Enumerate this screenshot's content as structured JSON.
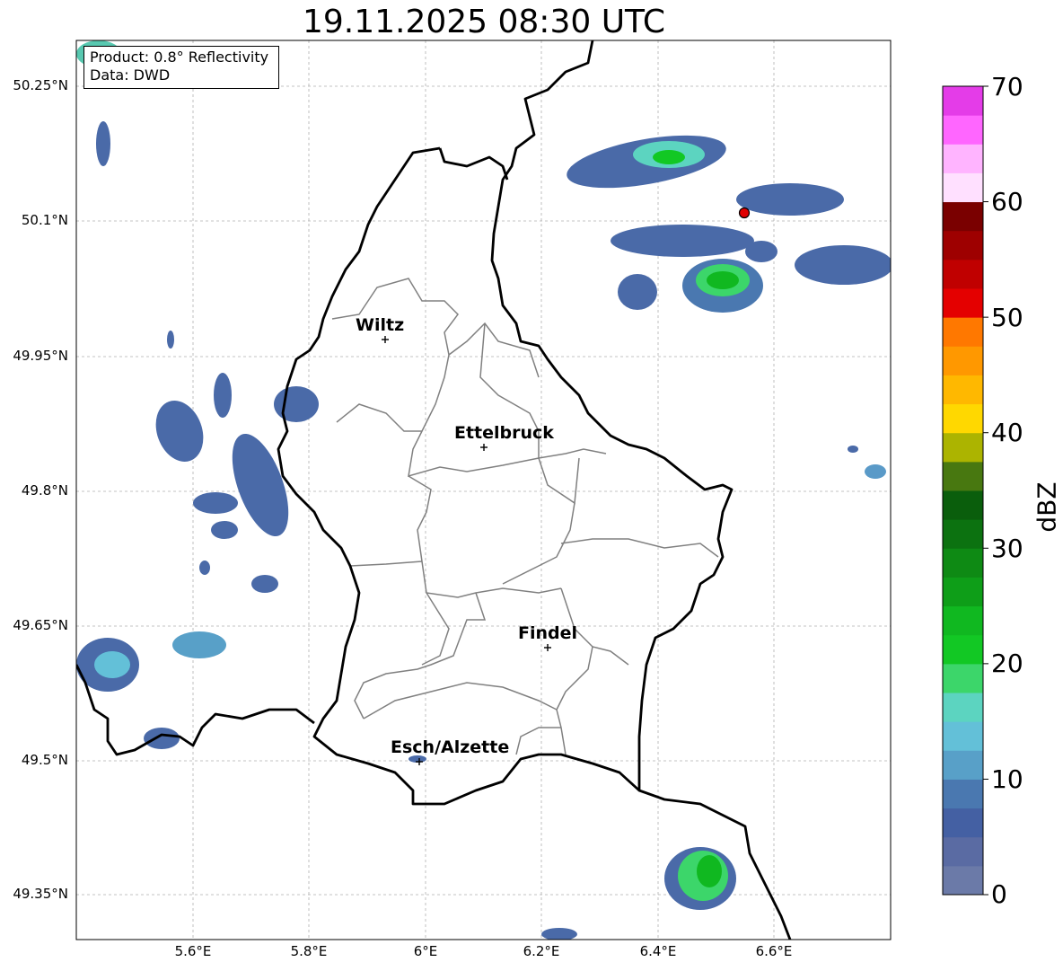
{
  "title": "19.11.2025 08:30 UTC",
  "info": {
    "product": "Product: 0.8° Reflectivity",
    "data": "Data: DWD"
  },
  "lat_ticks": [
    "50.25°N",
    "50.1°N",
    "49.95°N",
    "49.8°N",
    "49.65°N",
    "49.5°N",
    "49.35°N"
  ],
  "lon_ticks": [
    "5.6°E",
    "5.8°E",
    "6°E",
    "6.2°E",
    "6.4°E",
    "6.6°E"
  ],
  "cities": [
    {
      "name": "Wiltz",
      "lon": 5.93,
      "lat": 49.967
    },
    {
      "name": "Ettelbruck",
      "lon": 6.1,
      "lat": 49.847
    },
    {
      "name": "Findel",
      "lon": 6.21,
      "lat": 49.627
    },
    {
      "name": "Esch/Alzette",
      "lon": 5.99,
      "lat": 49.5
    }
  ],
  "radar_site": {
    "lon": 6.547,
    "lat": 50.11
  },
  "colorbar": {
    "label": "dBZ",
    "min": 0,
    "max": 70,
    "step": 2.5,
    "tick_labels": [
      "0",
      "10",
      "20",
      "30",
      "40",
      "50",
      "60",
      "70"
    ],
    "colors": [
      "#6b7aa8",
      "#5a6ba3",
      "#4460a3",
      "#4a78b0",
      "#58a0c8",
      "#63c0d8",
      "#5cd4c0",
      "#3cd66a",
      "#12c824",
      "#10b820",
      "#0e9e18",
      "#0e8a14",
      "#0c7210",
      "#0a5e0c",
      "#487810",
      "#acb400",
      "#ffd800",
      "#ffb800",
      "#ff9800",
      "#ff7800",
      "#e40000",
      "#c00000",
      "#9e0000",
      "#7a0000",
      "#ffe0ff",
      "#ffb4ff",
      "#ff66ff",
      "#e43ce8"
    ]
  },
  "map_extent": {
    "lon_min": 5.4,
    "lon_max": 6.8,
    "lat_min": 49.3,
    "lat_max": 50.3
  }
}
